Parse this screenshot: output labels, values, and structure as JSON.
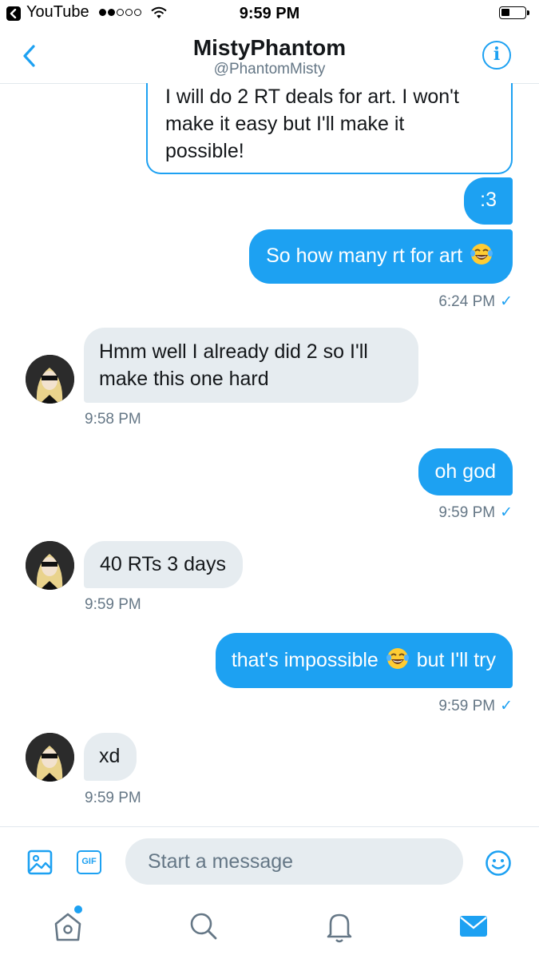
{
  "status_bar": {
    "back_app": "YouTube",
    "time": "9:59 PM",
    "signal_bars_filled": 2,
    "signal_bars_total": 5
  },
  "header": {
    "title": "MistyPhantom",
    "handle": "@PhantomMisty"
  },
  "messages": [
    {
      "direction": "out",
      "text": "I will do 2 RT deals for art. I won't make it easy but I'll make it possible!"
    },
    {
      "direction": "out",
      "text": ":3"
    },
    {
      "direction": "out",
      "text": "So how many rt for art",
      "emoji": "face-with-tears-of-joy"
    },
    {
      "direction": "out",
      "timestamp": "6:24 PM",
      "read": "✓"
    },
    {
      "direction": "in",
      "text": "Hmm well I already did 2 so I'll make this one hard",
      "timestamp": "9:58 PM"
    },
    {
      "direction": "out",
      "text": "oh god",
      "timestamp": "9:59 PM",
      "read": "✓"
    },
    {
      "direction": "in",
      "text": "40 RTs 3 days",
      "timestamp": "9:59 PM"
    },
    {
      "direction": "out",
      "text_before": "that's impossible",
      "emoji": "face-with-tears-of-joy",
      "text_after": "but I'll try",
      "timestamp": "9:59 PM",
      "read": "✓"
    },
    {
      "direction": "in",
      "text": "xd",
      "timestamp": "9:59 PM"
    }
  ],
  "message_lines": {
    "m0_l1": "I will do 2 RT deals for art. I won't",
    "m0_l2": "make it easy but I'll make it",
    "m0_l3": "possible!",
    "m4_l1": "Hmm well I already did 2 so I'll",
    "m4_l2": "make this one hard"
  },
  "composer": {
    "placeholder": "Start a message",
    "gif_label": "GIF"
  },
  "tabs": [
    "home",
    "search",
    "notifications",
    "messages"
  ],
  "colors": {
    "accent": "#1da1f2",
    "incoming_bubble": "#e6ecf0",
    "secondary_text": "#657786"
  }
}
